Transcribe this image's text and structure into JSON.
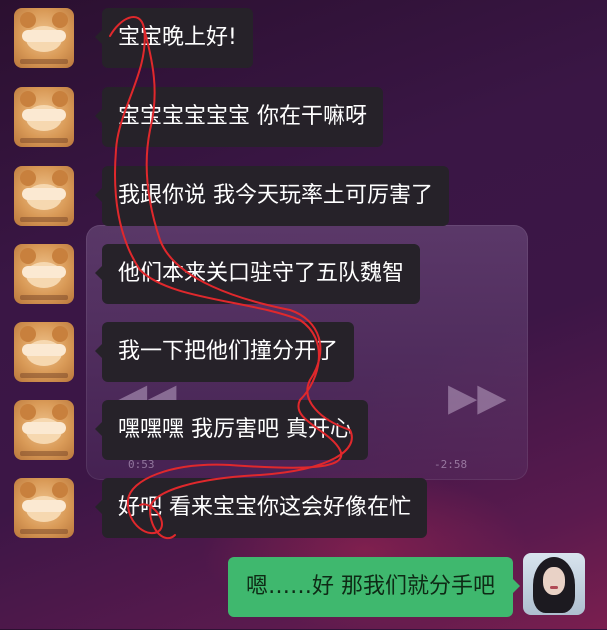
{
  "messages": [
    {
      "text": "宝宝晚上好!"
    },
    {
      "text": "宝宝宝宝宝宝 你在干嘛呀"
    },
    {
      "text": "我跟你说 我今天玩率土可厉害了"
    },
    {
      "text": "他们本来关口驻守了五队魏智"
    },
    {
      "text": "我一下把他们撞分开了"
    },
    {
      "text": "嘿嘿嘿 我厉害吧 真开心"
    },
    {
      "text": "好吧 看来宝宝你这会好像在忙"
    }
  ],
  "reply": {
    "text": "嗯……好 那我们就分手吧"
  },
  "background_player": {
    "elapsed": "0:53",
    "remaining": "-2:58",
    "rewind_icon": "rewind-icon",
    "forward_icon": "fast-forward-icon"
  },
  "colors": {
    "incoming_bubble": "#262229",
    "outgoing_bubble": "#3fb86e",
    "annotation_stroke": "#e0282c"
  }
}
